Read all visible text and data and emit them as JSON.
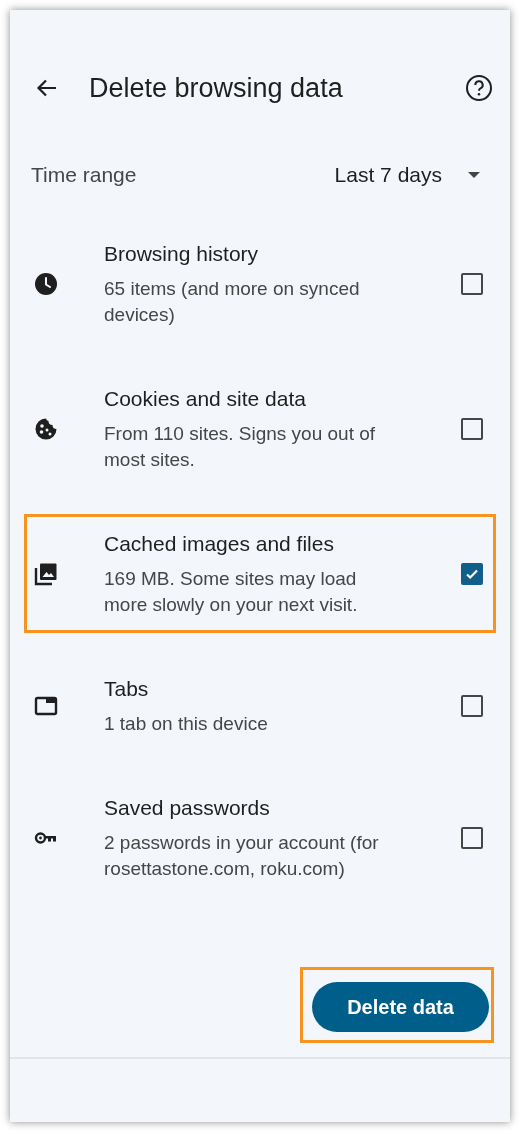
{
  "header": {
    "title": "Delete browsing data"
  },
  "time_range": {
    "label": "Time range",
    "value": "Last 7 days"
  },
  "items": [
    {
      "kind": "history",
      "title": "Browsing history",
      "description": "65 items (and more on synced devices)",
      "checked": false,
      "highlighted": false
    },
    {
      "kind": "cookies",
      "title": "Cookies and site data",
      "description": "From 110 sites. Signs you out of most sites.",
      "checked": false,
      "highlighted": false
    },
    {
      "kind": "cache",
      "title": "Cached images and files",
      "description": "169 MB. Some sites may load more slowly on your next visit.",
      "checked": true,
      "highlighted": true
    },
    {
      "kind": "tabs",
      "title": "Tabs",
      "description": "1 tab on this device",
      "checked": false,
      "highlighted": false
    },
    {
      "kind": "passwords",
      "title": "Saved passwords",
      "description": "2 passwords in your account (for rosettastone.com, roku.com)",
      "checked": false,
      "highlighted": false
    }
  ],
  "delete_button": {
    "label": "Delete data",
    "highlighted": true
  }
}
